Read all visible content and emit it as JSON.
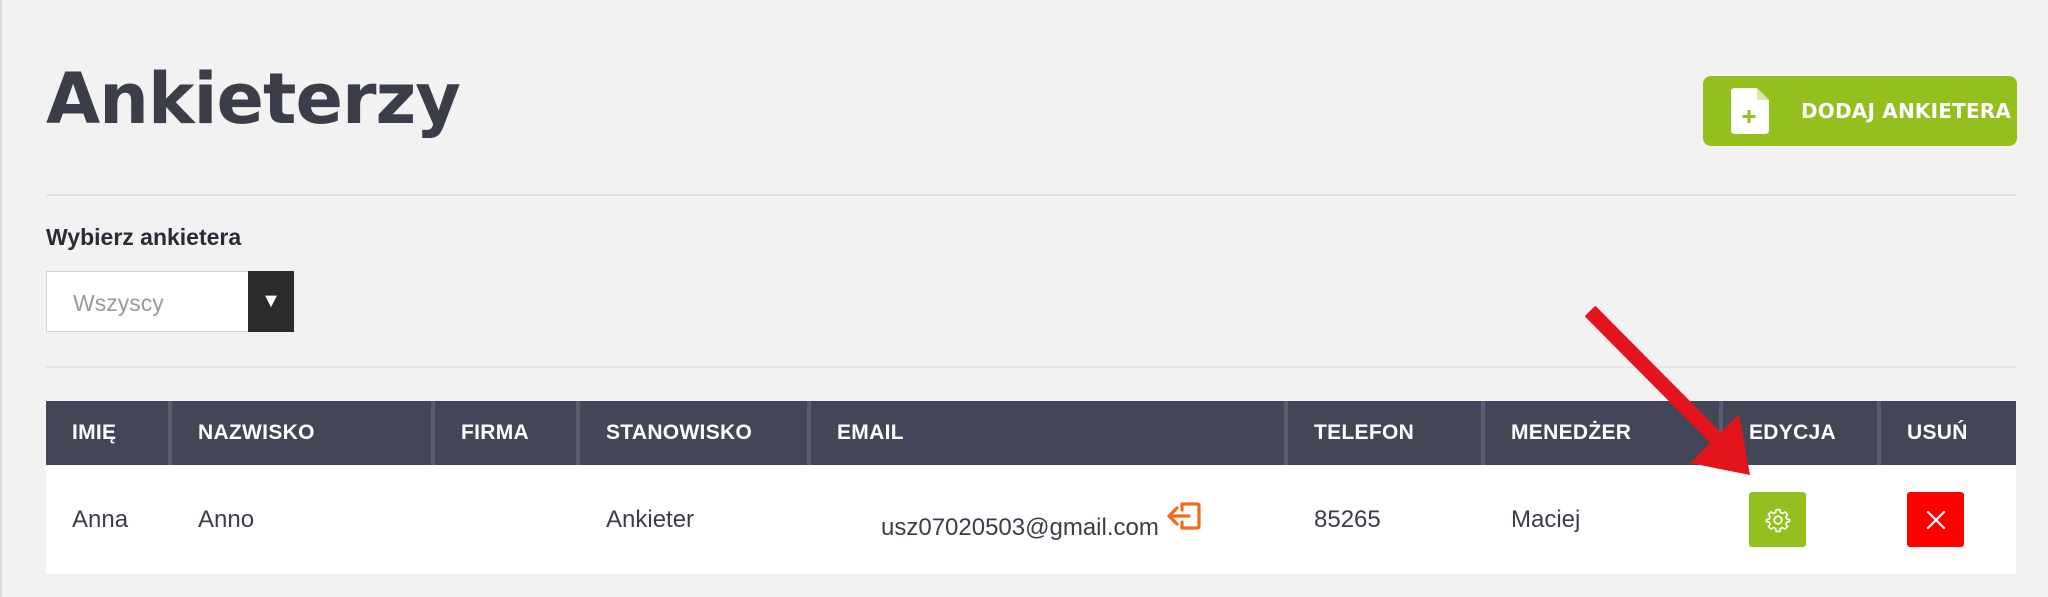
{
  "page": {
    "title": "Ankieterzy"
  },
  "add_button": {
    "label": "DODAJ ANKIETERA",
    "icon": "document-plus-icon"
  },
  "filter": {
    "label": "Wybierz ankietera",
    "selected": "Wszyscy",
    "arrow": "▼"
  },
  "table": {
    "columns": [
      "IMIĘ",
      "NAZWISKO",
      "FIRMA",
      "STANOWISKO",
      "EMAIL",
      "TELEFON",
      "MENEDŻER",
      "EDYCJA",
      "USUŃ"
    ],
    "rows": [
      {
        "first_name": "Anna",
        "last_name": "Anno",
        "company": "",
        "position": "Ankieter",
        "email": "usz07020503@gmail.com",
        "phone": "85265",
        "manager": "Maciej"
      }
    ]
  },
  "colors": {
    "accent_green": "#93c01f",
    "delete_red": "#ff0000",
    "header_dark": "#434656",
    "login_icon_orange": "#f26a1b",
    "annotation_arrow": "#e3141b"
  }
}
